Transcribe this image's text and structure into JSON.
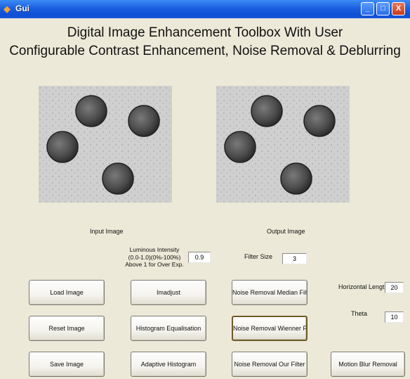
{
  "window": {
    "title": "Gui",
    "controls": {
      "minimize": "_",
      "maximize": "□",
      "close": "X"
    }
  },
  "header": {
    "line1": "Digital Image Enhancement Toolbox With User",
    "line2": "Configurable Contrast Enhancement, Noise Removal & Deblurring"
  },
  "panels": {
    "input_label": "Input Image",
    "output_label": "Output Image"
  },
  "params": {
    "luminous_label": "Luminous Intensity (0.0-1.0)(0%-100%) Above 1 for Over Exp.",
    "luminous_value": "0.9",
    "filter_size_label": "Filter Size",
    "filter_size_value": "3",
    "horizontal_length_label": "Horizontal Length",
    "horizontal_length_value": "20",
    "theta_label": "Theta",
    "theta_value": "10"
  },
  "buttons": {
    "load": "Load Image",
    "reset": "Reset Image",
    "save": "Save Image",
    "imadjust": "Imadjust",
    "histeq": "Histogram Equalisation",
    "adapthist": "Adaptive Histogram",
    "median": "Noise Removal Median Filter",
    "wiener": "Noise Removal Wienner Filter",
    "our_filter": "Noise Removal Our Filter",
    "motion_blur": "Motion Blur Removal"
  },
  "colors": {
    "titlebar": "#1c5fe0",
    "window_bg": "#ece9d8",
    "image_bg": "#cfcfcf",
    "coin": "#555555"
  }
}
